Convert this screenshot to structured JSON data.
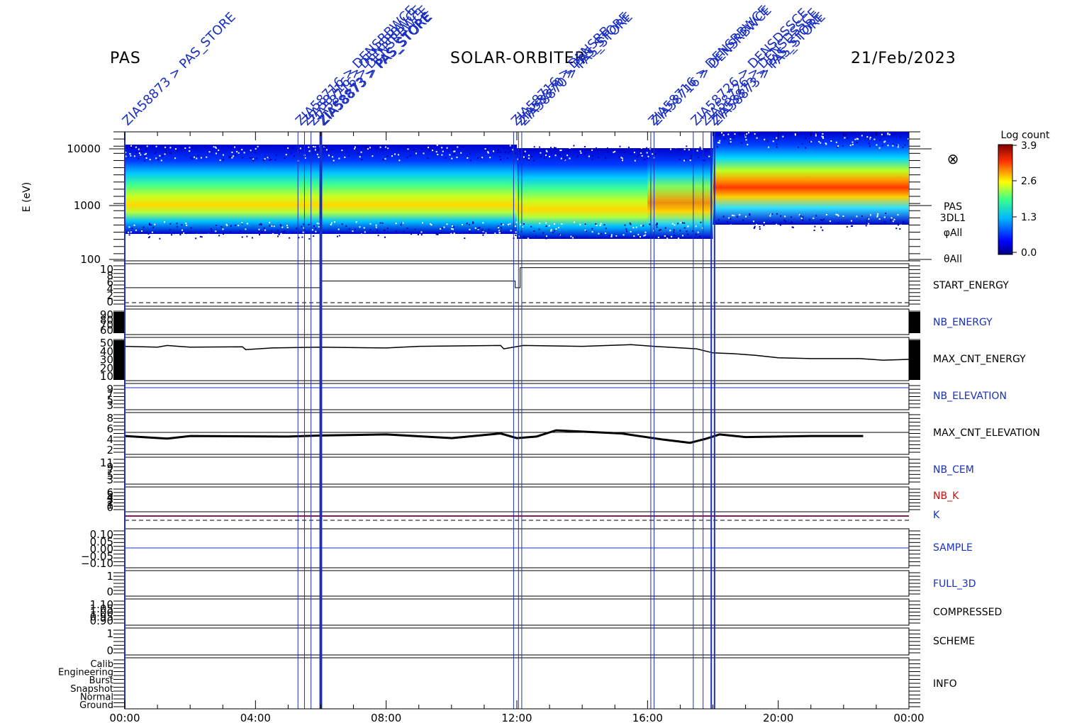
{
  "header": {
    "left": "PAS",
    "center": "SOLAR-ORBITER",
    "right": "21/Feb/2023"
  },
  "colors": {
    "label_blue": "#1a2fc2",
    "label_red": "#d01010",
    "black": "#000000",
    "k_line": "#8b1a5a"
  },
  "spectrogram": {
    "ylabel": "E (eV)",
    "yticks": [
      "10000",
      "1000",
      "100"
    ],
    "side_labels": [
      "PAS",
      "3DL1",
      "φAll",
      "θAll"
    ],
    "colorbar": {
      "title": "Log count",
      "ticks": [
        "3.9",
        "2.6",
        "1.3",
        "0.0"
      ]
    },
    "symbol": "⊗"
  },
  "chart_data": {
    "type": "line",
    "x_ticks": [
      "00:00",
      "04:00",
      "08:00",
      "12:00",
      "16:00",
      "20:00",
      "00:00"
    ],
    "xlim_hours": [
      0,
      24
    ],
    "events": [
      {
        "t": 0.0,
        "label": "ZIA58873 > PAS_STORE"
      },
      {
        "t": 5.3,
        "label": "ZIA58716 > DENSRBWCE"
      },
      {
        "t": 5.5,
        "label": "ZIA58716 > DENSRBWCE"
      },
      {
        "t": 5.7,
        "label": "ZIA58716 > DENSRBWCE"
      },
      {
        "t": 5.98,
        "label": "ZIA58873 > PAS_STORE"
      },
      {
        "t": 6.02,
        "label": "ZIA58873 > PAS_STORE"
      },
      {
        "t": 11.9,
        "label": "ZIA58716 > DENSRB"
      },
      {
        "t": 12.05,
        "label": "ZIA58870 > PAS_STORE"
      },
      {
        "t": 12.15,
        "label": "ZIA58870 > PAS_STORE"
      },
      {
        "t": 16.1,
        "label": "ZIA58716 > DENSRBWCE"
      },
      {
        "t": 16.2,
        "label": "ZIA58716 > DENSRBWCE"
      },
      {
        "t": 17.4,
        "label": "ZIA58726 > DENSDSSCE"
      },
      {
        "t": 17.7,
        "label": "ZIA58726 > DENSDSSCE"
      },
      {
        "t": 17.95,
        "label": "ZIA58873 > PAS_STORE"
      },
      {
        "t": 18.05,
        "label": "ZIA58873 > PAS_STORE"
      }
    ],
    "panels": [
      {
        "label": "START_ENERGY",
        "color": "black",
        "ticks": [
          "10",
          "8",
          "6",
          "4",
          "2",
          "0"
        ]
      },
      {
        "label": "NB_ENERGY",
        "color": "blue",
        "ticks": [
          "90",
          "80",
          "70",
          "60"
        ]
      },
      {
        "label": "MAX_CNT_ENERGY",
        "color": "black",
        "ticks": [
          "50",
          "40",
          "30",
          "20",
          "10"
        ]
      },
      {
        "label": "NB_ELEVATION",
        "color": "blue",
        "ticks": [
          "9",
          "7",
          "5",
          "3"
        ]
      },
      {
        "label": "MAX_CNT_ELEVATION",
        "color": "black",
        "ticks": [
          "8",
          "6",
          "4",
          "2"
        ]
      },
      {
        "label": "NB_CEM",
        "color": "blue",
        "ticks": [
          "11",
          "9",
          "7",
          "5",
          "3"
        ]
      },
      {
        "label": "NB_K",
        "color": "red",
        "ticks": [
          "6",
          "5",
          "4",
          "3",
          "2",
          "1",
          "0"
        ]
      },
      {
        "label": "K",
        "color": "blue",
        "ticks": []
      },
      {
        "label": "SAMPLE",
        "color": "blue",
        "ticks": [
          "0.10",
          "0.05",
          "0.00",
          "−0.05",
          "−0.10"
        ]
      },
      {
        "label": "FULL_3D",
        "color": "blue",
        "ticks": [
          "1",
          "0"
        ]
      },
      {
        "label": "COMPRESSED",
        "color": "black",
        "ticks": [
          "1.10",
          "1.05",
          "1.00",
          "0.95",
          "0.90"
        ]
      },
      {
        "label": "SCHEME",
        "color": "black",
        "ticks": [
          "1",
          "0"
        ]
      },
      {
        "label": "INFO",
        "color": "black",
        "ticks": [
          "Calib",
          "Engineering",
          "Burst",
          "Snapshot",
          "Normal",
          "Ground"
        ]
      }
    ],
    "start_energy_series": [
      [
        0,
        4.5
      ],
      [
        6.0,
        4.5
      ],
      [
        6.0,
        6.5
      ],
      [
        11.95,
        6.5
      ],
      [
        11.95,
        4.5
      ],
      [
        12.1,
        4.5
      ],
      [
        12.1,
        10.5
      ],
      [
        18.0,
        10.5
      ],
      [
        18.0,
        10.5
      ],
      [
        24,
        10.5
      ]
    ],
    "max_cnt_energy_series": [
      [
        0,
        46
      ],
      [
        1,
        45
      ],
      [
        1.3,
        47
      ],
      [
        2,
        45
      ],
      [
        3.6,
        45.5
      ],
      [
        3.7,
        42
      ],
      [
        4.5,
        44
      ],
      [
        6,
        45
      ],
      [
        8,
        44
      ],
      [
        9,
        46
      ],
      [
        11.5,
        47
      ],
      [
        11.6,
        43
      ],
      [
        11.9,
        45
      ],
      [
        12.2,
        47
      ],
      [
        14,
        46
      ],
      [
        15.5,
        48
      ],
      [
        16.2,
        46
      ],
      [
        17.5,
        43
      ],
      [
        18,
        38
      ],
      [
        18.6,
        37
      ],
      [
        19.3,
        35
      ],
      [
        20,
        32
      ],
      [
        21,
        31
      ],
      [
        22.5,
        31
      ],
      [
        23.2,
        29
      ],
      [
        24,
        30
      ]
    ],
    "max_cnt_elevation_series": [
      [
        0,
        4.3
      ],
      [
        1.3,
        3.8
      ],
      [
        2,
        4.3
      ],
      [
        5,
        4.2
      ],
      [
        6,
        4.4
      ],
      [
        8,
        4.6
      ],
      [
        10,
        3.9
      ],
      [
        11.5,
        4.8
      ],
      [
        12,
        3.9
      ],
      [
        12.6,
        4.2
      ],
      [
        13.2,
        5.4
      ],
      [
        15.2,
        4.8
      ],
      [
        16.5,
        3.6
      ],
      [
        17.3,
        3.0
      ],
      [
        17.8,
        3.8
      ],
      [
        18.2,
        4.6
      ],
      [
        19,
        4.1
      ],
      [
        21,
        4.3
      ],
      [
        22.6,
        4.3
      ]
    ]
  }
}
